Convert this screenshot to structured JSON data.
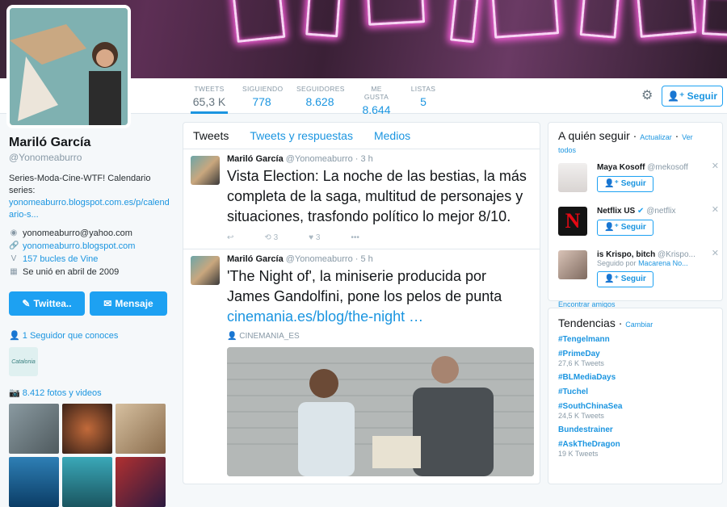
{
  "nav": {
    "stats": [
      {
        "label": "TWEETS",
        "value": "65,3 K"
      },
      {
        "label": "SIGUIENDO",
        "value": "778"
      },
      {
        "label": "SEGUIDORES",
        "value": "8.628"
      },
      {
        "label": "ME GUSTA",
        "value": "8.644"
      },
      {
        "label": "LISTAS",
        "value": "5"
      }
    ],
    "follow_label": "Seguir"
  },
  "profile": {
    "name": "Mariló García",
    "handle": "@Yonomeaburro",
    "bio": "Series-Moda-Cine-WTF! Calendario series:",
    "bio_link": "yonomeaburro.blogspot.com.es/p/calendario-s...",
    "email": "yonomeaburro@yahoo.com",
    "website": "yonomeaburro.blogspot.com",
    "vine": "157 bucles de Vine",
    "joined": "Se unió en abril de 2009",
    "tweet_btn": "Twittea..",
    "message_btn": "Mensaje",
    "known_followers": "1 Seguidor que conoces",
    "known_logo": "Catalonia",
    "photos": "8.412 fotos y videos"
  },
  "timeline": {
    "tabs": [
      "Tweets",
      "Tweets y respuestas",
      "Medios"
    ],
    "tweets": [
      {
        "name": "Mariló García",
        "handle": "@Yonomeaburro",
        "time": "· 3 h",
        "text": "Vista Election: La noche de las bestias, la más completa de la saga, multitud de personajes y situaciones, trasfondo político lo mejor 8/10.",
        "retweets": "3",
        "likes": "3"
      },
      {
        "name": "Mariló García",
        "handle": "@Yonomeaburro",
        "time": "· 5 h",
        "text": "'The Night of', la miniserie producida por James Gandolfini, pone los pelos de punta",
        "link": "cinemania.es/blog/the-night …",
        "source": "CINEMANIA_ES"
      }
    ]
  },
  "who_to_follow": {
    "title": "A quién seguir",
    "refresh": "Actualizar",
    "view_all": "Ver todos",
    "users": [
      {
        "name": "Maya Kosoff",
        "handle": "@mekosoff",
        "sub": "",
        "sub_link": ""
      },
      {
        "name": "Netflix US",
        "handle": "@netflix",
        "sub": "",
        "sub_link": ""
      },
      {
        "name": "is Krispo, bitch",
        "handle": "@Krispo...",
        "sub": "Seguido por",
        "sub_link": "Macarena No..."
      }
    ],
    "follow_label": "Seguir",
    "find_friends": "Encontrar amigos"
  },
  "trends": {
    "title": "Tendencias",
    "change": "Cambiar",
    "items": [
      {
        "name": "#Tengelmann",
        "count": ""
      },
      {
        "name": "#PrimeDay",
        "count": "27,6 K Tweets"
      },
      {
        "name": "#BLMediaDays",
        "count": ""
      },
      {
        "name": "#Tuchel",
        "count": ""
      },
      {
        "name": "#SouthChinaSea",
        "count": "24,5 K Tweets"
      },
      {
        "name": "Bundestrainer",
        "count": ""
      },
      {
        "name": "#AskTheDragon",
        "count": "19 K Tweets"
      }
    ]
  }
}
